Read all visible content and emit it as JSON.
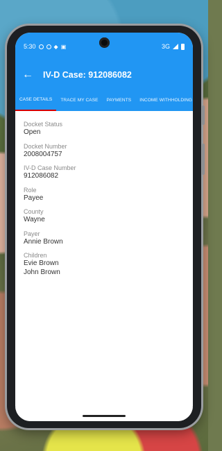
{
  "status_bar": {
    "time": "5:30",
    "network": "3G"
  },
  "app_bar": {
    "title": "IV-D Case: 912086082"
  },
  "tabs": [
    {
      "label": "CASE DETAILS",
      "active": true
    },
    {
      "label": "TRACE MY CASE",
      "active": false
    },
    {
      "label": "PAYMENTS",
      "active": false
    },
    {
      "label": "INCOME WITHHOLDING",
      "active": false
    }
  ],
  "details": {
    "docket_status": {
      "label": "Docket Status",
      "value": "Open"
    },
    "docket_number": {
      "label": "Docket Number",
      "value": "2008004757"
    },
    "ivd_case_number": {
      "label": "IV-D Case Number",
      "value": "912086082"
    },
    "role": {
      "label": "Role",
      "value": "Payee"
    },
    "county": {
      "label": "County",
      "value": "Wayne"
    },
    "payer": {
      "label": "Payer",
      "value": "Annie Brown"
    },
    "children": {
      "label": "Children",
      "values": [
        "Evie Brown",
        "John Brown"
      ]
    }
  },
  "colors": {
    "primary": "#2196f3",
    "tab_indicator": "#d50000"
  }
}
